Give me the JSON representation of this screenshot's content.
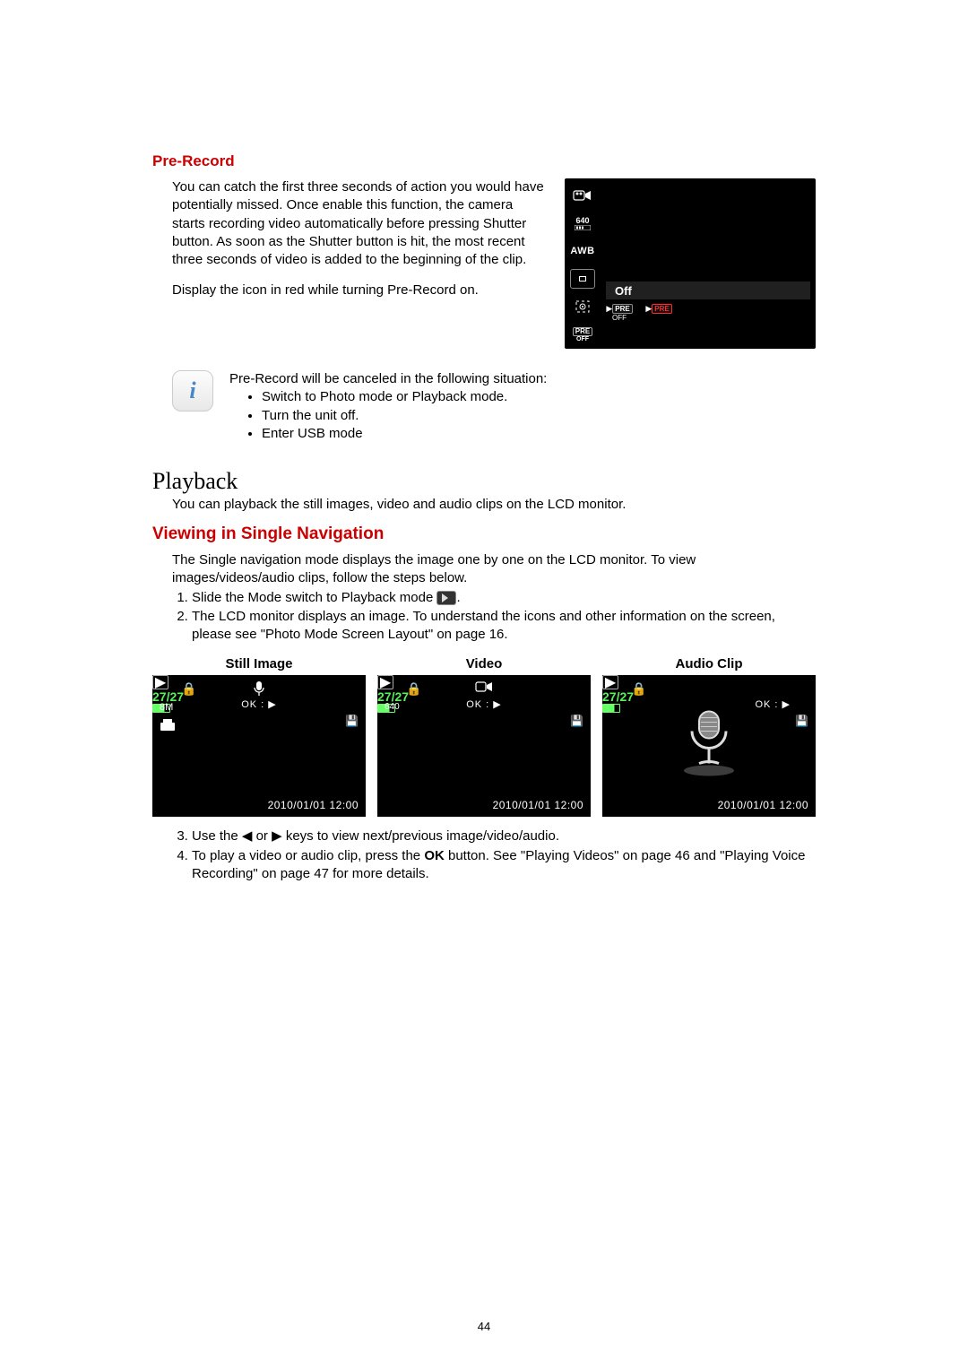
{
  "prerecord": {
    "title": "Pre-Record",
    "para1": "You can catch the first three seconds of action you would have potentially missed. Once enable this function, the camera starts recording video automatically before pressing Shutter button. As soon as the Shutter button is hit, the most recent three seconds of video is added to the beginning of the clip.",
    "para2": "Display the icon in red while turning Pre-Record on.",
    "lcd_awb": "AWB",
    "lcd_640": "640",
    "lcd_off_label": "Off",
    "lcd_pre": "PRE",
    "lcd_pre_off": "OFF"
  },
  "note": {
    "lead": "Pre-Record will be canceled in the following situation:",
    "b1": "Switch to Photo mode or Playback mode.",
    "b2": "Turn the unit off.",
    "b3": "Enter USB mode"
  },
  "playback": {
    "heading": "Playback",
    "intro": "You can playback the still images, video and audio clips on the LCD monitor."
  },
  "viewing": {
    "heading": "Viewing in Single Navigation",
    "p1": "The Single navigation mode displays the image one by one on the LCD monitor. To view images/videos/audio clips, follow the steps below.",
    "step1_a": "Slide the Mode switch to Playback mode ",
    "step1_b": ".",
    "step2": "The LCD monitor displays an image. To understand the icons and other information on the screen, please see \"Photo Mode Screen Layout\" on page 16.",
    "thumbs": {
      "still_title": "Still Image",
      "video_title": "Video",
      "audio_title": "Audio Clip",
      "count": "27/27",
      "ok": "OK : ▶",
      "datetime": "2010/01/01 12:00",
      "size_8m": "8M",
      "size_640": "640"
    },
    "step3_a": "Use the ",
    "step3_b": " or ",
    "step3_c": " keys to view next/previous image/video/audio.",
    "step4": "To play a video or audio clip, press the OK button. See \"Playing Videos\" on page 46 and \"Playing Voice Recording\" on page 47 for more details.",
    "step4_prefix": "To play a video or audio clip, press the ",
    "step4_bold": "OK",
    "step4_suffix": " button. See \"Playing Videos\" on page 46 and \"Playing Voice Recording\" on page 47 for more details."
  },
  "page_number": "44"
}
